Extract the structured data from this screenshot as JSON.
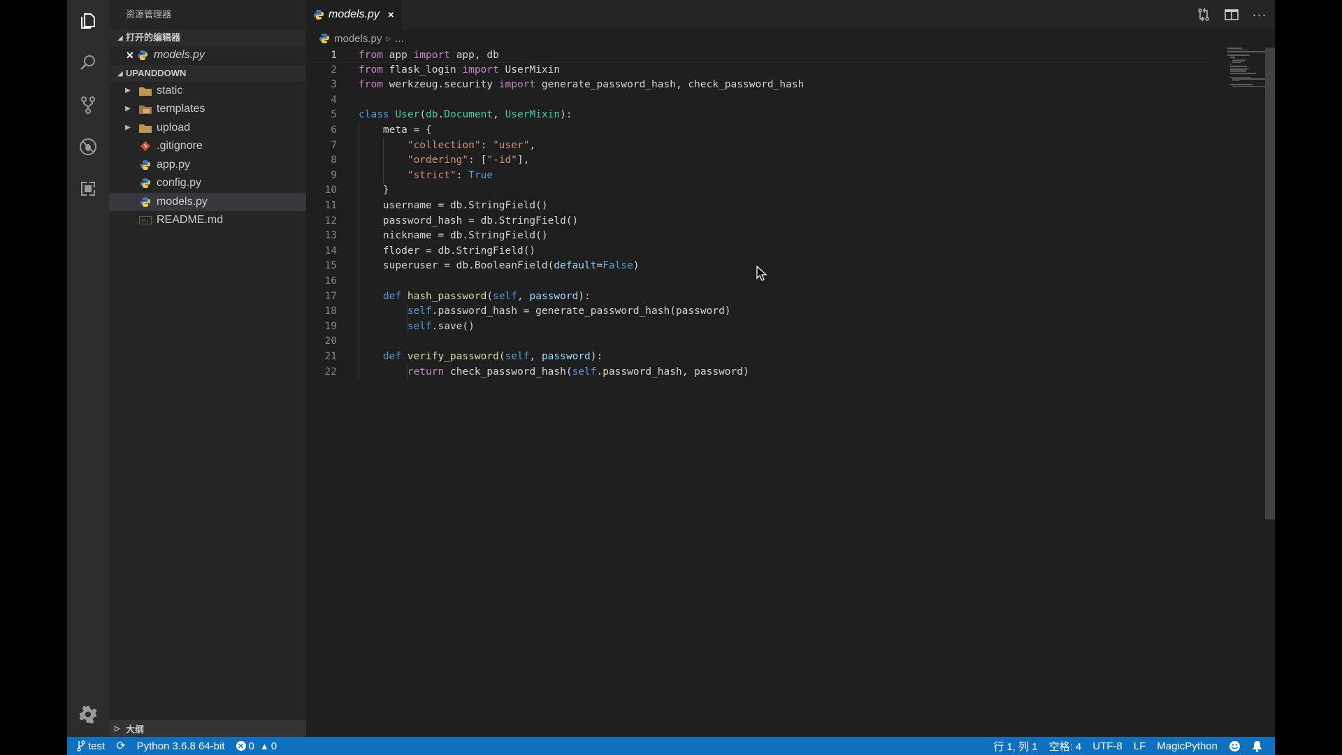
{
  "activity_bar": {
    "items": [
      {
        "name": "explorer",
        "icon": "files-icon"
      },
      {
        "name": "search",
        "icon": "search-icon"
      },
      {
        "name": "source-control",
        "icon": "source-control-icon"
      },
      {
        "name": "debug",
        "icon": "debug-icon"
      },
      {
        "name": "extensions",
        "icon": "extensions-icon"
      }
    ],
    "settings_icon": "gear-icon"
  },
  "sidebar": {
    "title": "资源管理器",
    "open_editors": {
      "header": "打开的编辑器",
      "items": [
        {
          "label": "models.py",
          "icon": "python-icon"
        }
      ]
    },
    "project": {
      "header": "UPANDDOWN",
      "items": [
        {
          "label": "static",
          "type": "folder",
          "icon": "folder-icon"
        },
        {
          "label": "templates",
          "type": "folder",
          "icon": "folder-templates-icon"
        },
        {
          "label": "upload",
          "type": "folder",
          "icon": "folder-icon"
        },
        {
          "label": ".gitignore",
          "type": "file",
          "icon": "git-icon"
        },
        {
          "label": "app.py",
          "type": "file",
          "icon": "python-icon"
        },
        {
          "label": "config.py",
          "type": "file",
          "icon": "python-icon"
        },
        {
          "label": "models.py",
          "type": "file",
          "icon": "python-icon",
          "selected": true
        },
        {
          "label": "README.md",
          "type": "file",
          "icon": "markdown-icon"
        }
      ]
    },
    "outline": {
      "header": "大纲"
    }
  },
  "editor": {
    "tab": {
      "label": "models.py",
      "close": "×"
    },
    "breadcrumb": {
      "file": "models.py",
      "more": "..."
    },
    "active_line": 1,
    "lines": [
      "from app import app, db",
      "from flask_login import UserMixin",
      "from werkzeug.security import generate_password_hash, check_password_hash",
      "",
      "class User(db.Document, UserMixin):",
      "    meta = {",
      "        \"collection\": \"user\",",
      "        \"ordering\": [\"-id\"],",
      "        \"strict\": True",
      "    }",
      "    username = db.StringField()",
      "    password_hash = db.StringField()",
      "    nickname = db.StringField()",
      "    floder = db.StringField()",
      "    superuser = db.BooleanField(default=False)",
      "",
      "    def hash_password(self, password):",
      "        self.password_hash = generate_password_hash(password)",
      "        self.save()",
      "",
      "    def verify_password(self, password):",
      "        return check_password_hash(self.password_hash, password)"
    ]
  },
  "status_bar": {
    "branch": "test",
    "interpreter": "Python 3.6.8 64-bit",
    "errors": "0",
    "warnings": "0",
    "position": "行 1, 列 1",
    "indent": "空格: 4",
    "encoding": "UTF-8",
    "eol": "LF",
    "language": "MagicPython",
    "color": "#0e70c0"
  }
}
